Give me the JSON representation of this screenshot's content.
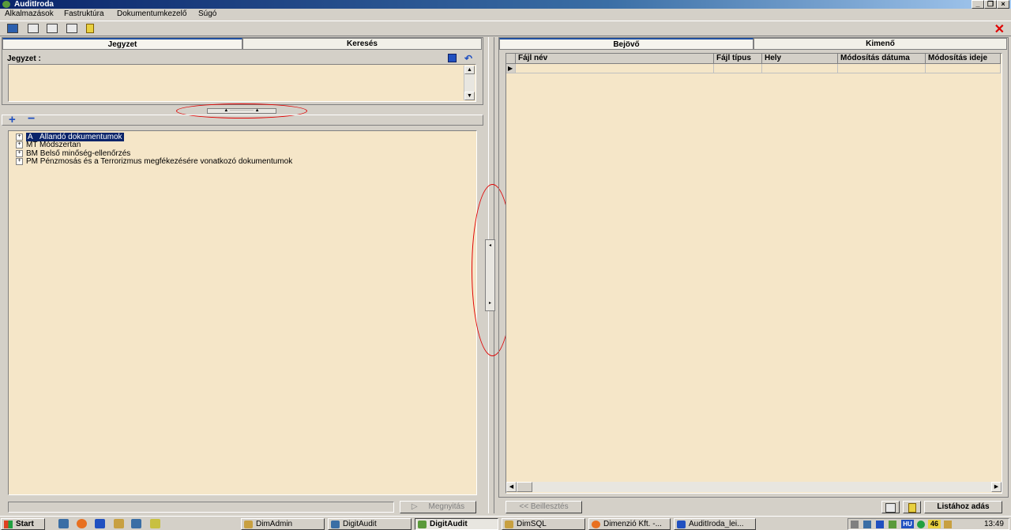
{
  "window": {
    "title": "AuditIroda"
  },
  "menu": [
    "Alkalmazások",
    "Fastruktúra",
    "Dokumentumkezelő",
    "Súgó"
  ],
  "left_panel": {
    "tabs": [
      "Jegyzet",
      "Keresés"
    ],
    "note_label": "Jegyzet :",
    "tree": [
      {
        "code": "A",
        "label": "Állandó dokumentumok",
        "selected": true
      },
      {
        "code": "MT",
        "label": "Módszertan"
      },
      {
        "code": "BM",
        "label": "Belső minőség-ellenőrzés"
      },
      {
        "code": "PM",
        "label": "Pénzmosás és a Terrorizmus megfékezésére vonatkozó dokumentumok"
      }
    ],
    "open_button": "Megnyitás"
  },
  "right_panel": {
    "tabs": [
      "Bejövő",
      "Kimenő"
    ],
    "columns": [
      "Fájl név",
      "Fájl típus",
      "Hely",
      "Módosítás dátuma",
      "Módosítás ideje"
    ],
    "paste_button": "<< Beillesztés",
    "add_to_list_button": "Listához adás"
  },
  "taskbar": {
    "start": "Start",
    "items": [
      "DimAdmin",
      "DigitAudit",
      "DigitAudit",
      "DimSQL",
      "Dimenzió Kft. -...",
      "AuditIroda_lei..."
    ],
    "active_index": 2,
    "tray": {
      "lang": "HU",
      "badge": "46",
      "clock": "13:49"
    }
  },
  "colors": {
    "cream": "#f5e6c8",
    "annotation_red": "#e00000",
    "titlebar": "#0a246a"
  }
}
